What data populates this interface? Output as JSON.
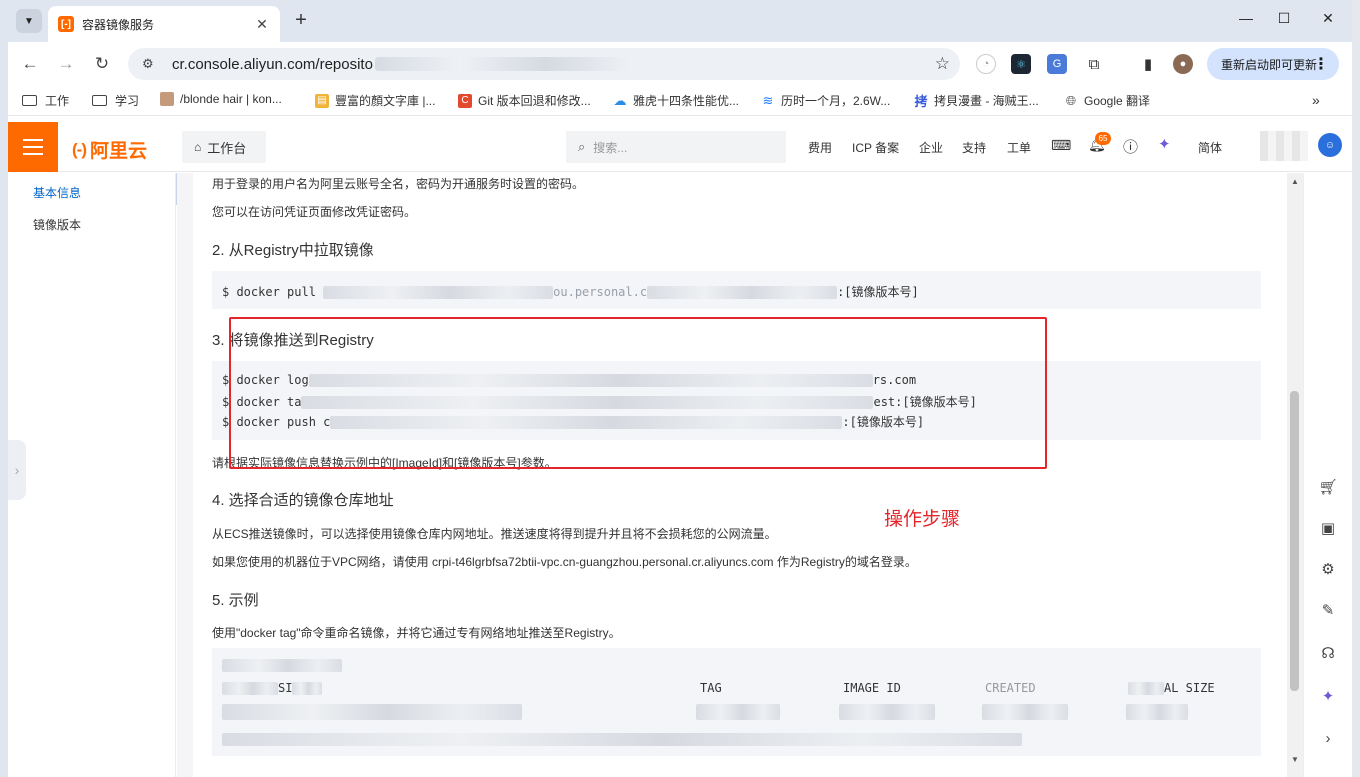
{
  "browser": {
    "tab_title": "容器镜像服务",
    "tab_favicon": "[-]",
    "url": "cr.console.aliyun.com/reposito",
    "restart_label": "重新启动即可更新",
    "bookmarks": [
      {
        "label": "工作"
      },
      {
        "label": "学习"
      },
      {
        "label": "/blonde hair | kon..."
      },
      {
        "label": "豐富的顏文字庫 |..."
      },
      {
        "label": "Git 版本回退和修改..."
      },
      {
        "label": "雅虎十四条性能优..."
      },
      {
        "label": "历时一个月，2.6W..."
      },
      {
        "label": "拷貝漫畫 - 海贼王..."
      },
      {
        "label": "Google 翻译"
      }
    ]
  },
  "header": {
    "logo_text": "阿里云",
    "logo_mark": "(-)",
    "workbench_label": "工作台",
    "search_placeholder": "搜索...",
    "nav": [
      "费用",
      "ICP 备案",
      "企业",
      "支持",
      "工单"
    ],
    "notification_count": "65",
    "lang_label": "简体"
  },
  "sidebar": {
    "items": [
      {
        "label": "基本信息",
        "active": true
      },
      {
        "label": "镜像版本",
        "active": false
      }
    ]
  },
  "content": {
    "p_login_1": "用于登录的用户名为阿里云账号全名，密码为开通服务时设置的密码。",
    "p_login_2": "您可以在访问凭证页面修改凭证密码。",
    "h2": "2. 从Registry中拉取镜像",
    "pull_cmd_prefix": "$ docker pull ",
    "pull_cmd_mid": "ou.personal.c",
    "pull_cmd_suffix": ":[镜像版本号]",
    "h3": "3. 将镜像推送到Registry",
    "login_cmd_prefix": "$ docker log",
    "login_cmd_suffix": "rs.com",
    "tag_cmd_prefix": "$ docker ta",
    "tag_cmd_suffix": "est:[镜像版本号]",
    "push_cmd_prefix": "$ docker push c",
    "push_cmd_suffix": ":[镜像版本号]",
    "p_replace": "请根据实际镜像信息替换示例中的[ImageId]和[镜像版本号]参数。",
    "h4": "4. 选择合适的镜像仓库地址",
    "p_ecs": "从ECS推送镜像时，可以选择使用镜像仓库内网地址。推送速度将得到提升并且将不会损耗您的公网流量。",
    "p_vpc": "如果您使用的机器位于VPC网络，请使用 crpi-t46lgrbfsa72btii-vpc.cn-guangzhou.personal.cr.aliyuncs.com 作为Registry的域名登录。",
    "h5": "5. 示例",
    "p_example": "使用\"docker tag\"命令重命名镜像，并将它通过专有网络地址推送至Registry。",
    "table_headers": {
      "col1": "SI",
      "tag": "TAG",
      "image_id": "IMAGE ID",
      "created": "CREATED",
      "size": "AL SIZE"
    },
    "annotation": "操作步骤"
  },
  "colors": {
    "brand": "#ff6a00",
    "link": "#0064c8",
    "annotation_red": "#e4262b"
  }
}
